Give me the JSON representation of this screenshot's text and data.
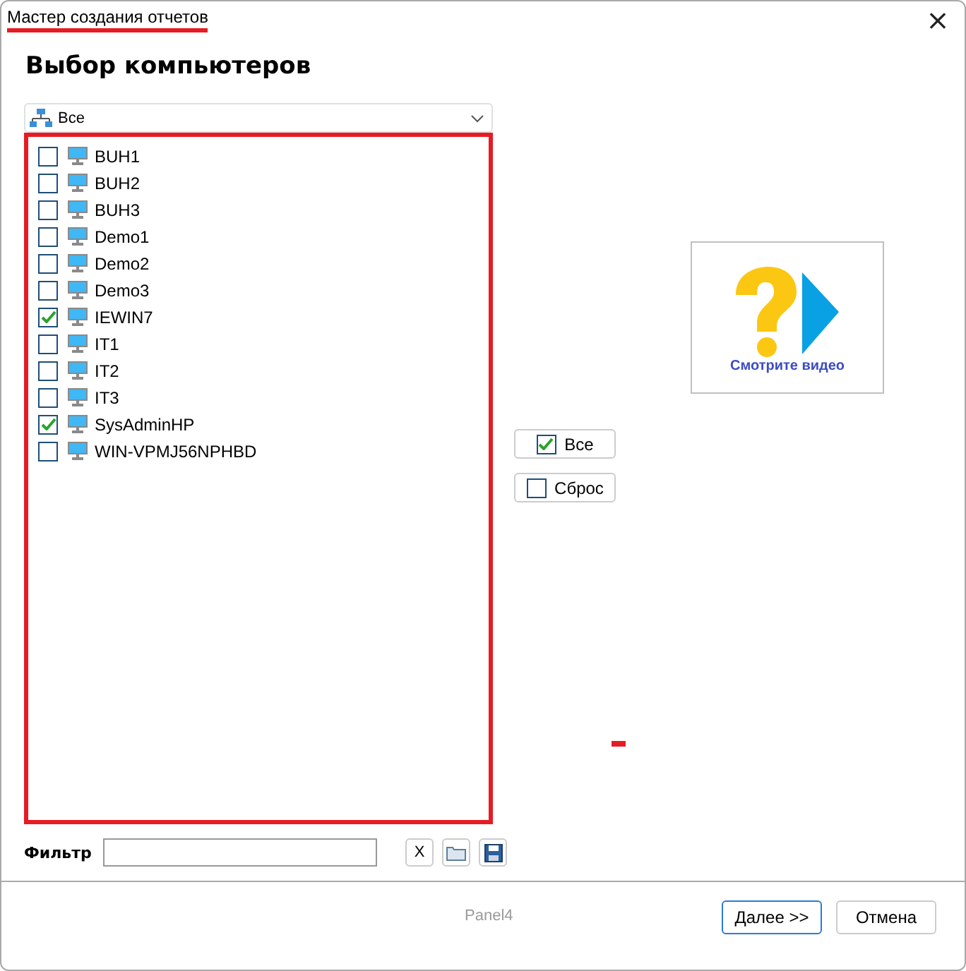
{
  "window": {
    "title": "Мастер создания отчетов",
    "close": "×"
  },
  "heading": "Выбор компьютеров",
  "group_dropdown": {
    "value": "Все"
  },
  "computers": [
    {
      "name": "BUH1",
      "checked": false
    },
    {
      "name": "BUH2",
      "checked": false
    },
    {
      "name": "BUH3",
      "checked": false
    },
    {
      "name": "Demo1",
      "checked": false
    },
    {
      "name": "Demo2",
      "checked": false
    },
    {
      "name": "Demo3",
      "checked": false
    },
    {
      "name": "IEWIN7",
      "checked": true
    },
    {
      "name": "IT1",
      "checked": false
    },
    {
      "name": "IT2",
      "checked": false
    },
    {
      "name": "IT3",
      "checked": false
    },
    {
      "name": "SysAdminHP",
      "checked": true
    },
    {
      "name": "WIN-VPMJ56NPHBD",
      "checked": false
    }
  ],
  "video": {
    "caption": "Смотрите видео"
  },
  "select_buttons": [
    {
      "label": "Все",
      "checked": true
    },
    {
      "label": "Сброс",
      "checked": false
    }
  ],
  "filter": {
    "label": "Фильтр",
    "clear": "X"
  },
  "footer": {
    "panel_label": "Panel4",
    "buttons": [
      {
        "label": "Далее >>",
        "default": true
      },
      {
        "label": "Отмена",
        "default": false
      }
    ]
  }
}
